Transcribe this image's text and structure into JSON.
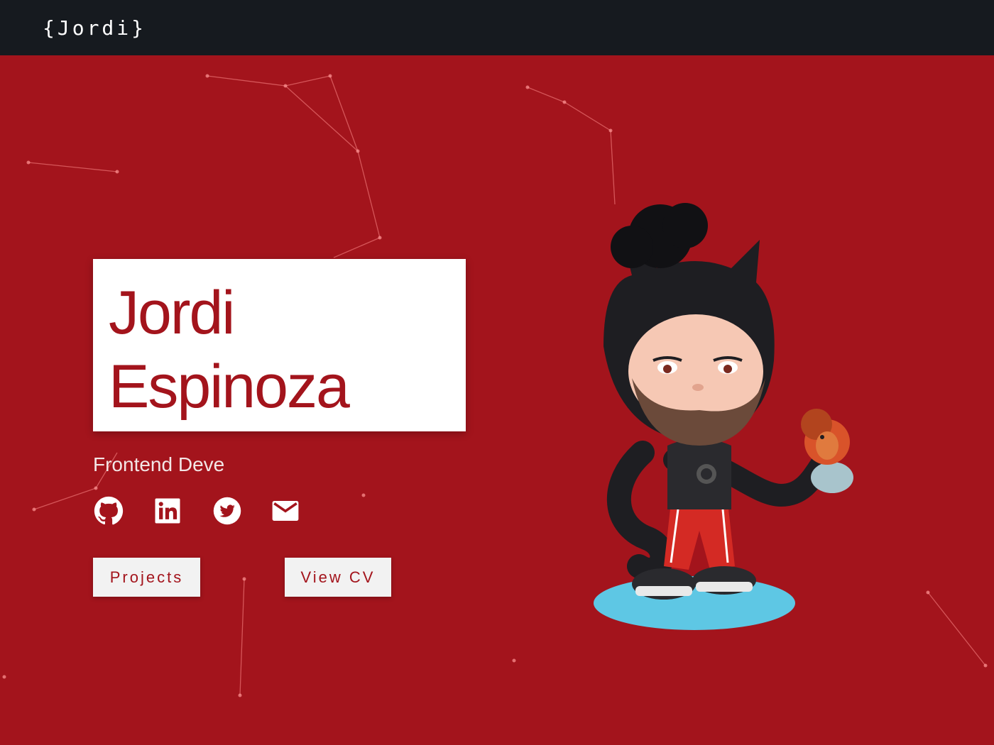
{
  "header": {
    "logo": "{Jordi}"
  },
  "hero": {
    "name_first": "Jordi",
    "name_last": "Espinoza",
    "subtitle": "Frontend Deve",
    "social": [
      {
        "name": "github",
        "icon": "github-icon"
      },
      {
        "name": "linkedin",
        "icon": "linkedin-icon"
      },
      {
        "name": "twitter",
        "icon": "twitter-icon"
      },
      {
        "name": "email",
        "icon": "mail-icon"
      }
    ],
    "buttons": {
      "projects": "Projects",
      "cv": "View CV"
    }
  },
  "colors": {
    "background": "#a3141c",
    "topbar": "#161a1f",
    "card": "#ffffff",
    "accent_text": "#a3141c"
  }
}
